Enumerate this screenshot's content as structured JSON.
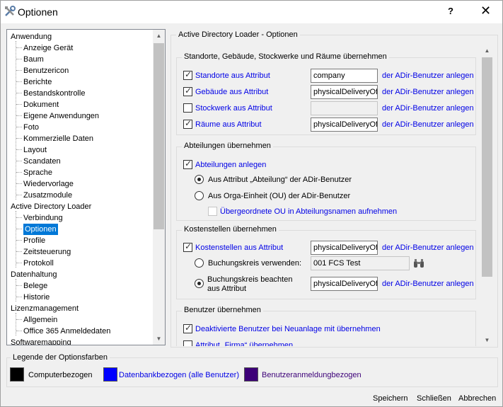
{
  "window": {
    "title": "Optionen",
    "help_label": "?",
    "close_label": "✕"
  },
  "tree": {
    "items": [
      {
        "label": "Anwendung",
        "level": 0
      },
      {
        "label": "Anzeige Gerät",
        "level": 1
      },
      {
        "label": "Baum",
        "level": 1
      },
      {
        "label": "Benutzericon",
        "level": 1
      },
      {
        "label": "Berichte",
        "level": 1
      },
      {
        "label": "Bestandskontrolle",
        "level": 1
      },
      {
        "label": "Dokument",
        "level": 1
      },
      {
        "label": "Eigene Anwendungen",
        "level": 1
      },
      {
        "label": "Foto",
        "level": 1
      },
      {
        "label": "Kommerzielle Daten",
        "level": 1
      },
      {
        "label": "Layout",
        "level": 1
      },
      {
        "label": "Scandaten",
        "level": 1
      },
      {
        "label": "Sprache",
        "level": 1
      },
      {
        "label": "Wiedervorlage",
        "level": 1
      },
      {
        "label": "Zusatzmodule",
        "level": 1
      },
      {
        "label": "Active Directory Loader",
        "level": 0
      },
      {
        "label": "Verbindung",
        "level": 1
      },
      {
        "label": "Optionen",
        "level": 1,
        "selected": true
      },
      {
        "label": "Profile",
        "level": 1
      },
      {
        "label": "Zeitsteuerung",
        "level": 1
      },
      {
        "label": "Protokoll",
        "level": 1
      },
      {
        "label": "Datenhaltung",
        "level": 0
      },
      {
        "label": "Belege",
        "level": 1
      },
      {
        "label": "Historie",
        "level": 1
      },
      {
        "label": "Lizenzmanagement",
        "level": 0
      },
      {
        "label": "Allgemein",
        "level": 1
      },
      {
        "label": "Office 365 Anmeldedaten",
        "level": 1
      },
      {
        "label": "Softwaremapping",
        "level": 0
      }
    ]
  },
  "panel": {
    "title": "Active Directory Loader - Optionen",
    "standorte": {
      "title": "Standorte, Gebäude, Stockwerke und Räume übernehmen",
      "rows": [
        {
          "label": "Standorte aus Attribut",
          "checked": true,
          "value": "company",
          "link": "der ADir-Benutzer anlegen"
        },
        {
          "label": "Gebäude aus Attribut",
          "checked": true,
          "value": "physicalDeliveryOf",
          "link": "der ADir-Benutzer anlegen"
        },
        {
          "label": "Stockwerk aus Attribut",
          "checked": false,
          "value": "",
          "link": "der ADir-Benutzer anlegen"
        },
        {
          "label": "Räume aus Attribut",
          "checked": true,
          "value": "physicalDeliveryOf",
          "link": "der ADir-Benutzer anlegen"
        }
      ]
    },
    "abteilungen": {
      "title": "Abteilungen übernehmen",
      "anlegen_label": "Abteilungen anlegen",
      "radio1_label": "Aus Attribut „Abteilung“ der ADir-Benutzer",
      "radio2_label": "Aus Orga-Einheit (OU) der ADir-Benutzer",
      "ou_label": "Übergeordnete OU in Abteilungsnamen aufnehmen"
    },
    "kostenstellen": {
      "title": "Kostenstellen übernehmen",
      "attr_label": "Kostenstellen aus Attribut",
      "attr_value": "physicalDeliveryOf",
      "link": "der ADir-Benutzer anlegen",
      "bk_verwenden_label": "Buchungskreis verwenden:",
      "bk_value": "001 FCS Test",
      "bk_beachten_line1": "Buchungskreis beachten",
      "bk_beachten_line2": "aus Attribut",
      "bk_attr_value": "physicalDeliveryOf",
      "bk_link": "der ADir-Benutzer anlegen"
    },
    "benutzer": {
      "title": "Benutzer übernehmen",
      "deaktiviert_label": "Deaktivierte Benutzer bei Neuanlage mit übernehmen",
      "firma_label": "Attribut „Firma“ übernehmen"
    }
  },
  "legend": {
    "title": "Legende der Optionsfarben",
    "items": [
      {
        "label": "Computerbezogen",
        "color": "#000000"
      },
      {
        "label": "Datenbankbezogen (alle Benutzer)",
        "color": "#0000ff"
      },
      {
        "label": "Benutzeranmeldungbezogen",
        "color": "#3c0078"
      }
    ]
  },
  "buttons": {
    "save": "Speichern",
    "close": "Schließen",
    "cancel": "Abbrechen"
  }
}
